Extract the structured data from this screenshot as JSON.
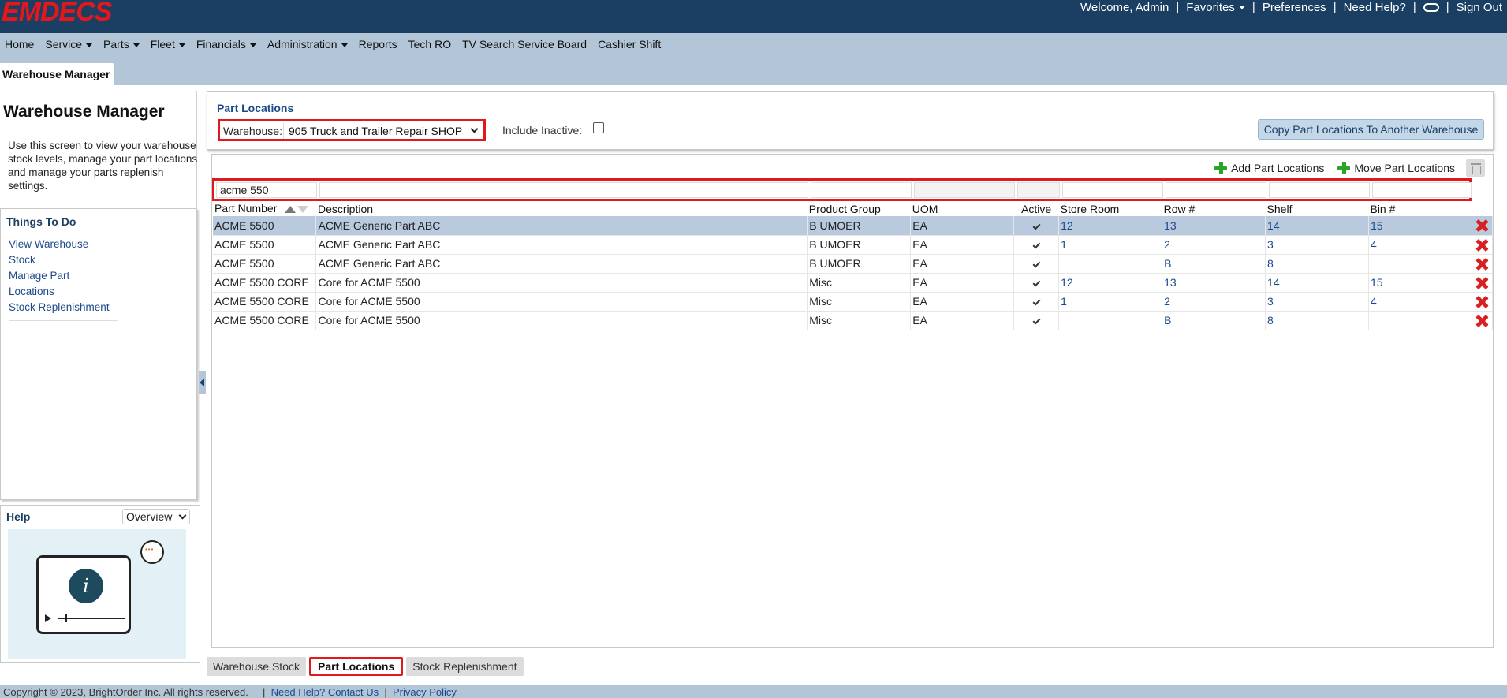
{
  "brand": {
    "logo_text": "EMDECS"
  },
  "topnav": {
    "welcome": "Welcome, Admin",
    "favorites": "Favorites",
    "preferences": "Preferences",
    "need_help": "Need Help?",
    "sign_out": "Sign Out"
  },
  "mainnav": [
    "Home",
    "Service",
    "Parts",
    "Fleet",
    "Financials",
    "Administration",
    "Reports",
    "Tech RO",
    "TV Search Service Board",
    "Cashier Shift"
  ],
  "page_tab": "Warehouse Manager",
  "sidebar": {
    "title": "Warehouse Manager",
    "description": "Use this screen to view your warehouse stock levels, manage your part locations and manage your parts replenish settings.",
    "todo_title": "Things To Do",
    "links": [
      "View Warehouse Stock",
      "Manage Part Locations",
      "Stock Replenishment"
    ],
    "help_title": "Help",
    "help_select": "Overview"
  },
  "panel": {
    "title": "Part Locations",
    "warehouse_label": "Warehouse:",
    "warehouse_value": "905 Truck and Trailer Repair SHOP",
    "include_inactive_label": "Include Inactive:",
    "copy_button": "Copy Part Locations To Another Warehouse"
  },
  "toolbar": {
    "add": "Add Part Locations",
    "move": "Move Part Locations"
  },
  "filter": {
    "part_number": "acme 550"
  },
  "table": {
    "columns": [
      "Part Number",
      "Description",
      "Product Group",
      "UOM",
      "Active",
      "Store Room",
      "Row #",
      "Shelf",
      "Bin #"
    ],
    "rows": [
      [
        "ACME 5500",
        "ACME Generic Part ABC",
        "B UMOER",
        "EA",
        "",
        "12",
        "13",
        "14",
        "15"
      ],
      [
        "ACME 5500",
        "ACME Generic Part ABC",
        "B UMOER",
        "EA",
        "",
        "1",
        "2",
        "3",
        "4"
      ],
      [
        "ACME 5500",
        "ACME Generic Part ABC",
        "B UMOER",
        "EA",
        "",
        "",
        "B",
        "8",
        ""
      ],
      [
        "ACME 5500 CORE",
        "Core for ACME 5500",
        "Misc",
        "EA",
        "",
        "12",
        "13",
        "14",
        "15"
      ],
      [
        "ACME 5500 CORE",
        "Core for ACME 5500",
        "Misc",
        "EA",
        "",
        "1",
        "2",
        "3",
        "4"
      ],
      [
        "ACME 5500 CORE",
        "Core for ACME 5500",
        "Misc",
        "EA",
        "",
        "",
        "B",
        "8",
        ""
      ]
    ]
  },
  "tabs": [
    "Warehouse Stock",
    "Part Locations",
    "Stock Replenishment"
  ],
  "footer": {
    "copyright": "Copyright © 2023, BrightOrder Inc. All rights reserved.",
    "contact": "Need Help? Contact Us",
    "privacy": "Privacy Policy"
  }
}
